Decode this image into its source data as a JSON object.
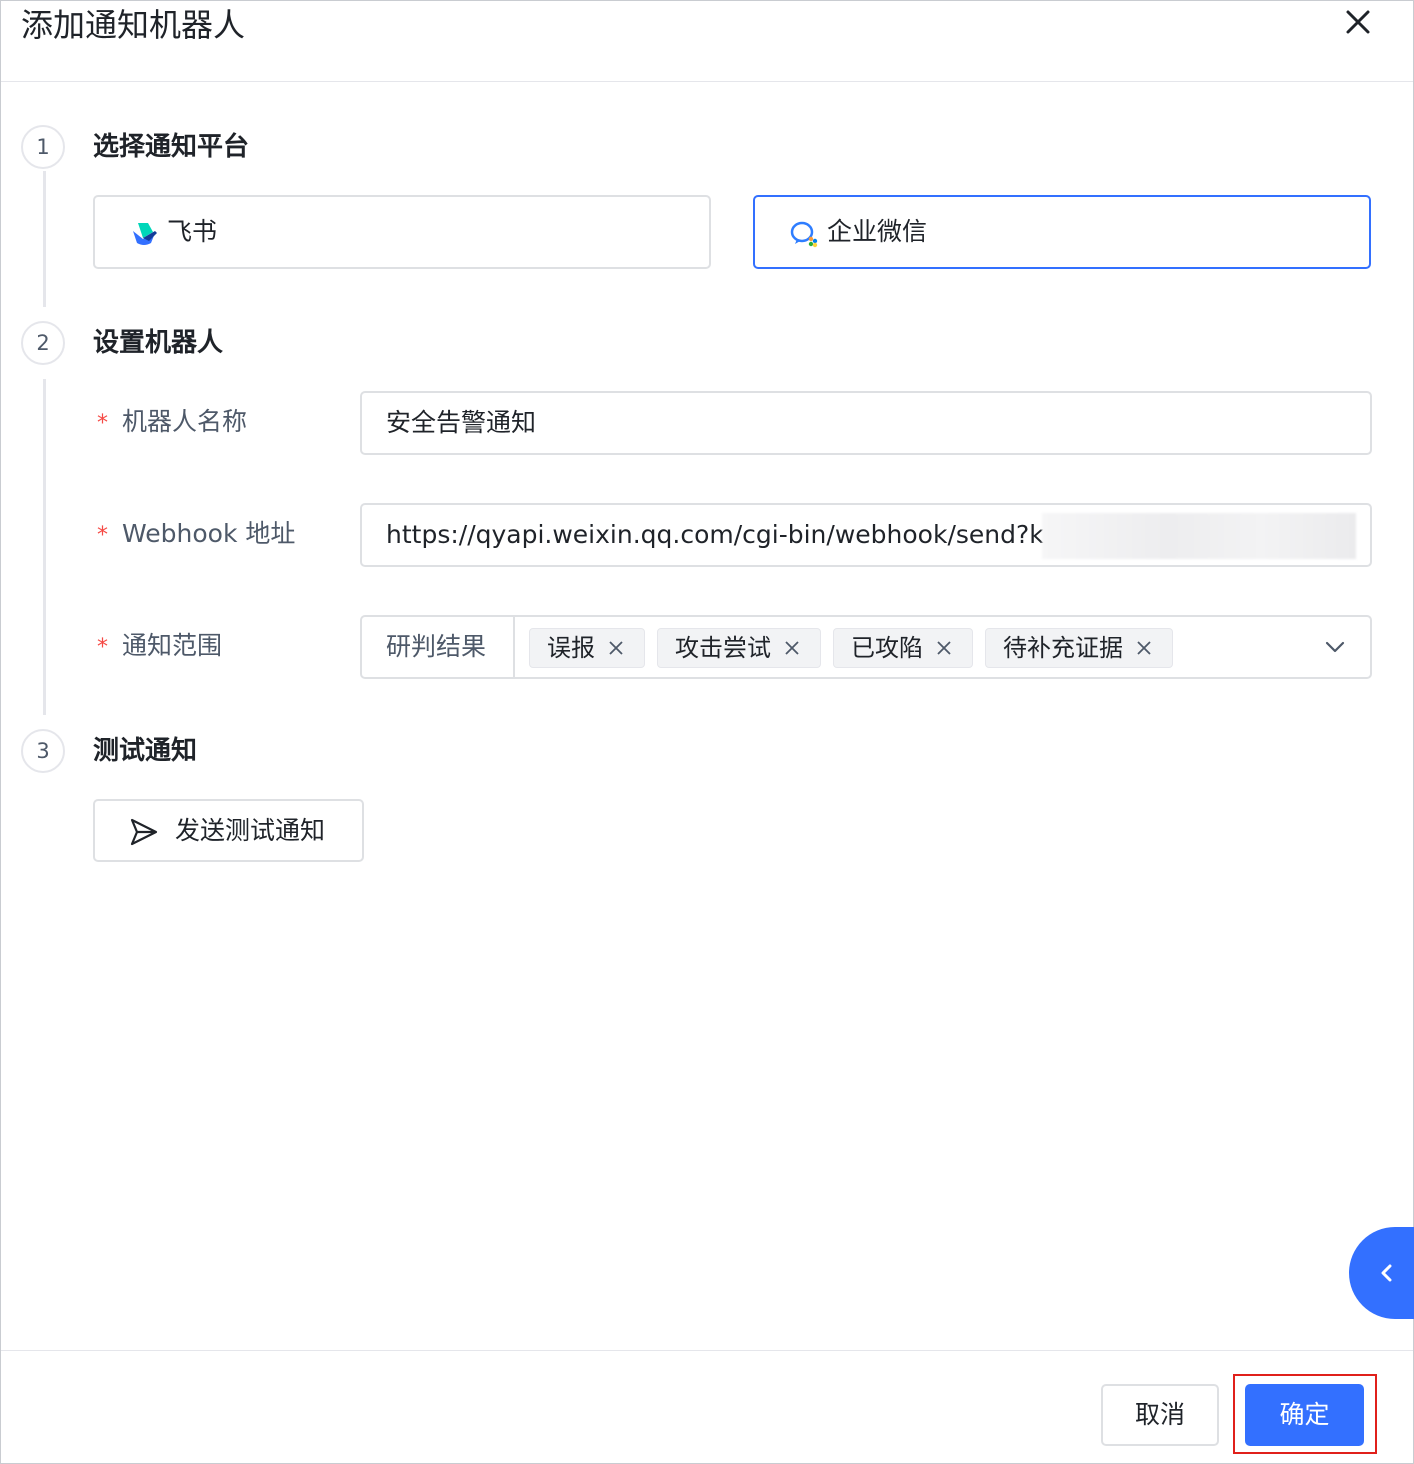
{
  "dialog": {
    "title": "添加通知机器人"
  },
  "steps": [
    {
      "number": "1",
      "title": "选择通知平台"
    },
    {
      "number": "2",
      "title": "设置机器人"
    },
    {
      "number": "3",
      "title": "测试通知"
    }
  ],
  "platforms": [
    {
      "label": "飞书",
      "icon": "feishu-logo-icon",
      "selected": false
    },
    {
      "label": "企业微信",
      "icon": "wecom-logo-icon",
      "selected": true
    }
  ],
  "form": {
    "required_mark": "*",
    "robot_name": {
      "label": "机器人名称",
      "value": "安全告警通知"
    },
    "webhook": {
      "label": "Webhook 地址",
      "value": "https://qyapi.weixin.qq.com/cgi-bin/webhook/send?key="
    },
    "scope": {
      "label": "通知范围",
      "prefix": "研判结果",
      "tags": [
        "误报",
        "攻击尝试",
        "已攻陷",
        "待补充证据"
      ]
    }
  },
  "test": {
    "button_label": "发送测试通知"
  },
  "footer": {
    "cancel_label": "取消",
    "ok_label": "确定"
  },
  "colors": {
    "primary": "#3370ff",
    "required": "#f54a45",
    "highlight": "#e0201b"
  }
}
